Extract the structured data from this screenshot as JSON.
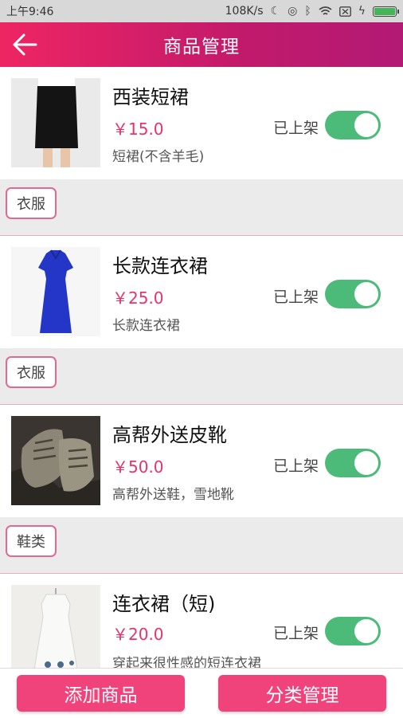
{
  "status_bar": {
    "time": "上午9:46",
    "net_speed": "108K/s",
    "battery_level": 1.0,
    "icons": [
      "moon-icon",
      "alarm-icon",
      "bluetooth-icon",
      "wifi-icon",
      "sim-icon",
      "charging-icon",
      "battery-icon"
    ]
  },
  "header": {
    "title": "商品管理",
    "back_icon": "arrow-left-icon"
  },
  "colors": {
    "accent": "#e8336a",
    "header_start": "#ee2563",
    "header_end": "#b21a74",
    "toggle_on": "#4cbb7a"
  },
  "products": [
    {
      "name": "西装短裙",
      "price": "￥15.0",
      "desc": "短裙(不含羊毛)",
      "status": "已上架",
      "category": "衣服",
      "image": "black-skirt-photo"
    },
    {
      "name": "长款连衣裙",
      "price": "￥25.0",
      "desc": "长款连衣裙",
      "status": "已上架",
      "category": "衣服",
      "image": "blue-dress-photo"
    },
    {
      "name": "高帮外送皮靴",
      "price": "￥50.0",
      "desc": "高帮外送鞋，雪地靴",
      "status": "已上架",
      "category": "鞋类",
      "image": "boots-photo"
    },
    {
      "name": "连衣裙（短)",
      "price": "￥20.0",
      "desc": "穿起来很性感的短连衣裙",
      "status": "已上架",
      "image": "white-dress-photo"
    }
  ],
  "bottom": {
    "add_label": "添加商品",
    "category_label": "分类管理"
  }
}
